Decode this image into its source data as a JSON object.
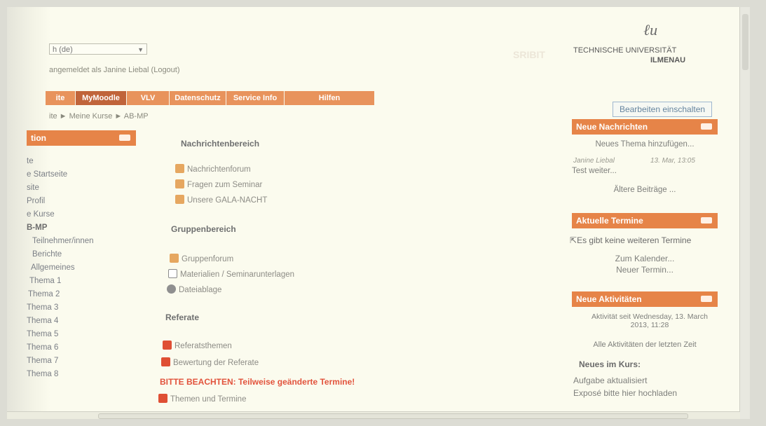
{
  "header": {
    "language": "h (de)",
    "login_text": "angemeldet als Janine Liebal (Logout)",
    "ghost_text": "SRIBIT",
    "logo": {
      "line1": "TECHNISCHE UNIVERSITÄT",
      "line2": "ILMENAU"
    }
  },
  "tabs": [
    {
      "label": "ite"
    },
    {
      "label": "MyMoodle"
    },
    {
      "label": "VLV"
    },
    {
      "label": "Datenschutz"
    },
    {
      "label": "Service Info"
    },
    {
      "label": "Hilfen"
    }
  ],
  "breadcrumb": "ite ► Meine Kurse ► AB-MP",
  "edit_button": "Bearbeiten einschalten",
  "navigation": {
    "title": "tion",
    "items": [
      "te",
      "e Startseite",
      "site",
      "Profil",
      "e Kurse",
      "B-MP",
      "Teilnehmer/innen",
      "Berichte",
      "Allgemeines",
      "Thema 1",
      "Thema 2",
      "Thema 3",
      "Thema 4",
      "Thema 5",
      "Thema 6",
      "Thema 7",
      "Thema 8"
    ]
  },
  "main": {
    "section1": {
      "title": "Nachrichtenbereich",
      "links": [
        "Nachrichtenforum",
        "Fragen zum Seminar",
        "Unsere GALA-NACHT"
      ]
    },
    "section2": {
      "title": "Gruppenbereich",
      "links": [
        "Gruppenforum",
        "Materialien / Seminarunterlagen",
        "Dateiablage"
      ]
    },
    "section3": {
      "title": "Referate",
      "links": [
        "Referatsthemen",
        "Bewertung der Referate"
      ],
      "notice": "BITTE BEACHTEN: Teilweise geänderte Termine!",
      "link3": "Themen und Termine"
    }
  },
  "news_block": {
    "title": "Neue Nachrichten",
    "add_topic": "Neues Thema hinzufügen...",
    "author": "Janine Liebal",
    "date": "13. Mar, 13:05",
    "post": "Test weiter...",
    "older": "Ältere Beiträge ..."
  },
  "events_block": {
    "title": "Aktuelle Termine",
    "empty": "Es gibt keine weiteren Termine",
    "calendar": "Zum Kalender...",
    "new_event": "Neuer Termin..."
  },
  "activity_block": {
    "title": "Neue Aktivitäten",
    "since": "Aktivität seit Wednesday, 13. March 2013, 11:28",
    "all": "Alle Aktivitäten der letzten Zeit",
    "course_news": "Neues im Kurs:",
    "item1": "Aufgabe aktualisiert",
    "item2": "Exposé bitte hier hochladen"
  },
  "colors": {
    "accent": "#e68448",
    "tab_active": "#c0643a",
    "warning": "#e2533c",
    "background": "#fbfbee"
  }
}
